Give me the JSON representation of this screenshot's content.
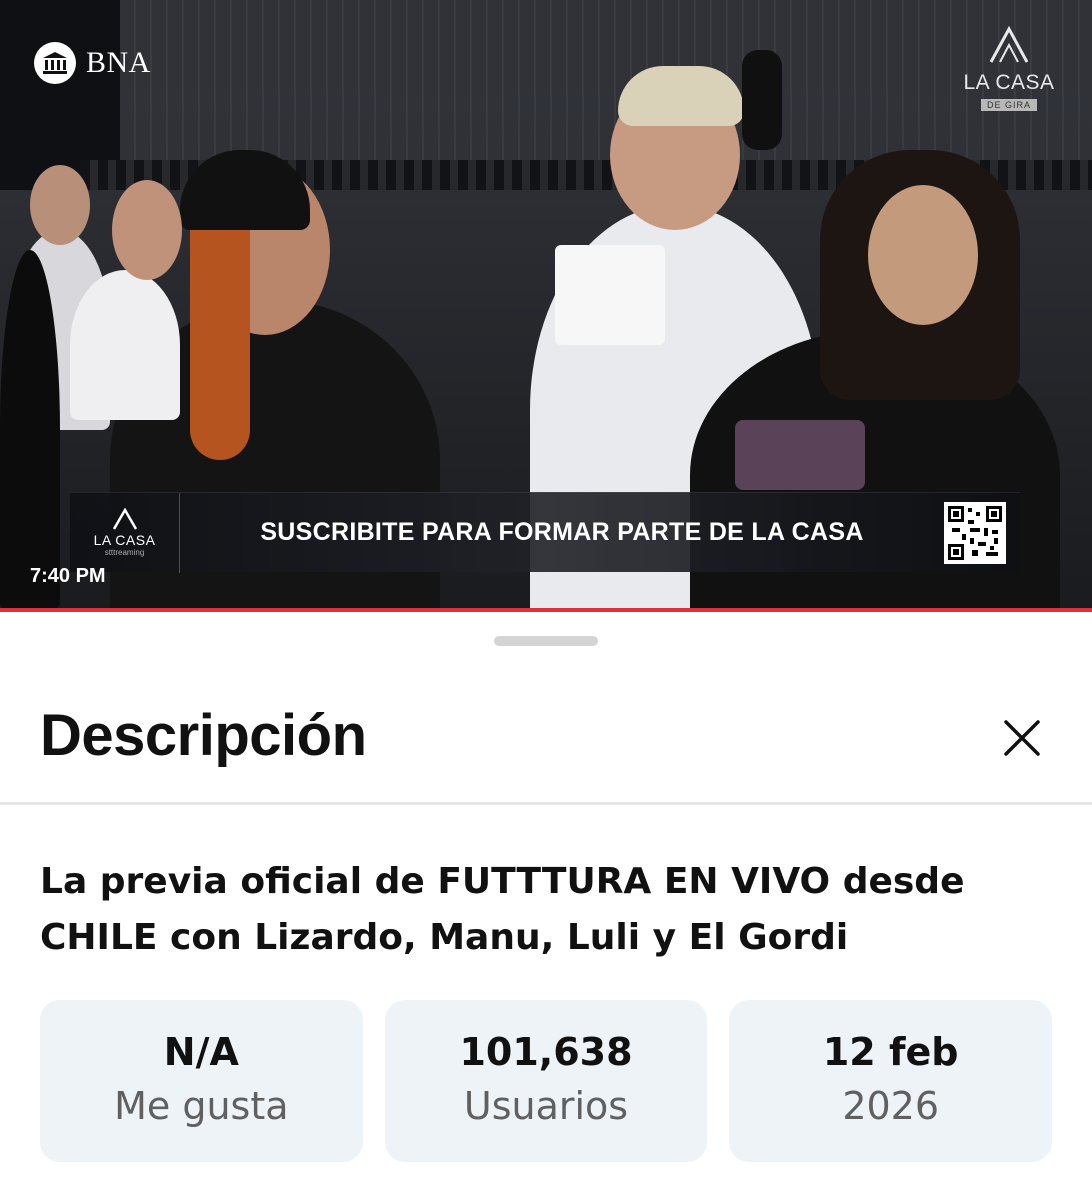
{
  "video": {
    "sponsor_logo_text": "BNA",
    "channel_logo_name": "LA CASA",
    "channel_logo_tag": "DE GIRA",
    "banner_logo_name": "LA CASA",
    "banner_logo_sub": "stttreaming",
    "banner_text": "SUSCRIBITE PARA FORMAR PARTE DE LA CASA",
    "clock": "7:40 PM",
    "progress_color": "#e0303a"
  },
  "sheet": {
    "title": "Descripción",
    "close_icon": "close-icon",
    "description_title": "La previa oficial de FUTTTURA EN VIVO desde CHILE con Lizardo, Manu, Luli y El Gordi",
    "stats": [
      {
        "value": "N/A",
        "label": "Me gusta"
      },
      {
        "value": "101,638",
        "label": "Usuarios"
      },
      {
        "value": "12 feb",
        "label": "2026"
      }
    ]
  }
}
